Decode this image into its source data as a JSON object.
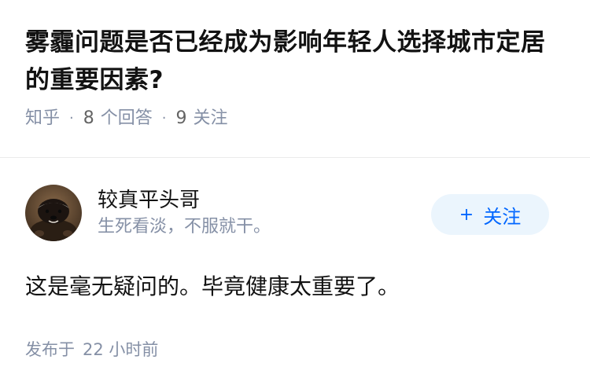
{
  "question": {
    "title": "雾霾问题是否已经成为影响年轻人选择城市定居的重要因素?",
    "source": "知乎",
    "answer_count": "8",
    "answer_label": "个回答",
    "follow_count": "9",
    "follow_label": "关注"
  },
  "answer": {
    "author_name": "较真平头哥",
    "author_bio": "生死看淡，不服就干。",
    "follow_button_label": "关注",
    "follow_button_icon": "plus-icon",
    "content": "这是毫无疑问的。毕竟健康太重要了。",
    "publish_prefix": "发布于",
    "publish_time": "22 小时前"
  },
  "colors": {
    "title": "#121212",
    "meta": "#8590a6",
    "accent": "#0066ff",
    "button_bg": "#ebf5fd"
  }
}
